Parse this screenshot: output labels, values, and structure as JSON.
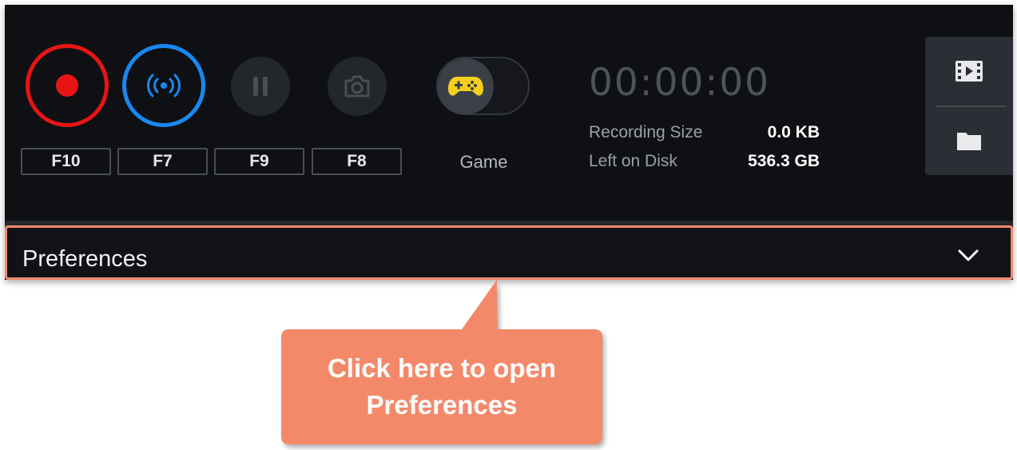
{
  "recorder": {
    "hotkeys": {
      "record": "F10",
      "stream": "F7",
      "pause": "F9",
      "screenshot": "F8"
    },
    "game_mode_label": "Game",
    "timer": "00:00:00",
    "stats": {
      "recording_size_label": "Recording Size",
      "recording_size_value": "0.0 KB",
      "left_on_disk_label": "Left on Disk",
      "left_on_disk_value": "536.3 GB"
    },
    "side_panel": {
      "top_icon": "film-icon",
      "bottom_icon": "folder-icon"
    },
    "icons": {
      "record": "record-icon",
      "stream": "broadcast-icon",
      "pause": "pause-icon",
      "screenshot": "camera-icon",
      "game": "gamepad-icon"
    },
    "colors": {
      "record": "#e81414",
      "stream": "#1888f0",
      "highlight": "#f3886c",
      "gamepad": "#f4d01c",
      "background": "#0f1014"
    }
  },
  "preferences": {
    "label": "Preferences",
    "chevron_icon": "chevron-down-icon"
  },
  "callout": {
    "line1": "Click here to open",
    "line2": "Preferences"
  }
}
